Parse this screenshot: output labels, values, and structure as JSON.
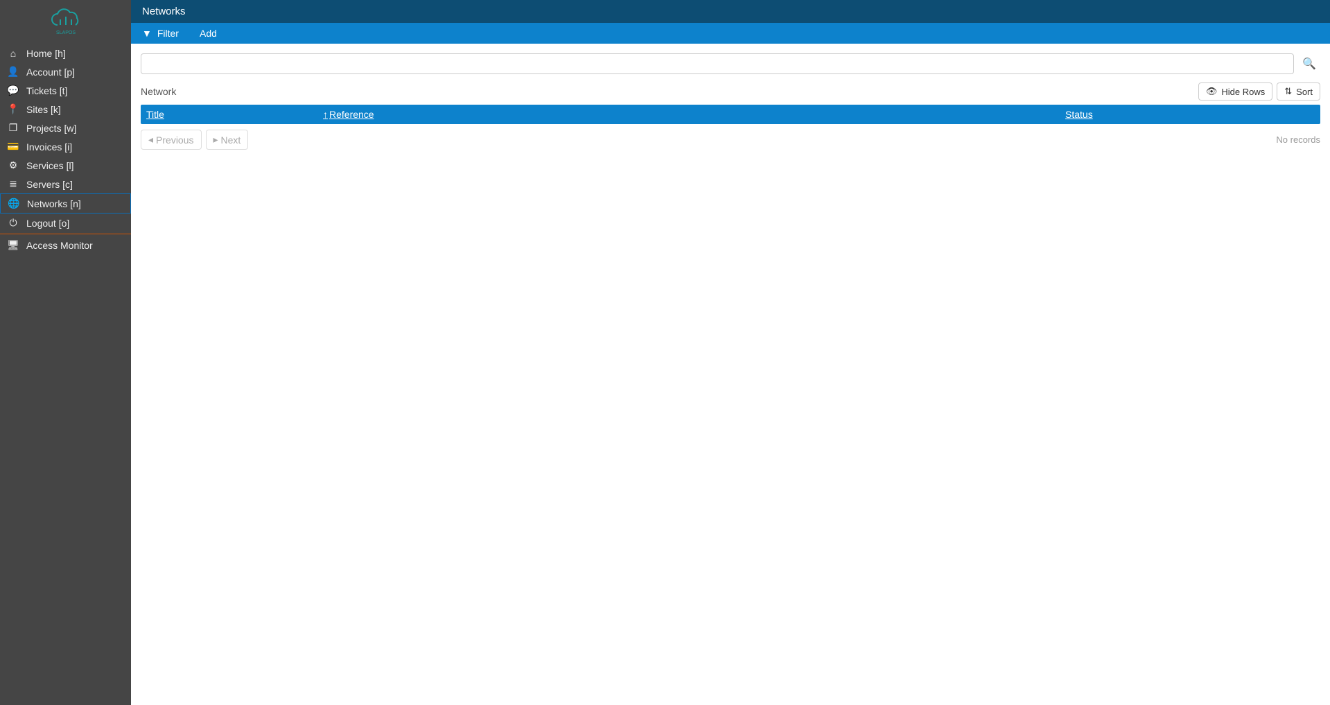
{
  "brand": {
    "name": "SLAPOS"
  },
  "sidebar": {
    "items": [
      {
        "label": "Home [h]",
        "icon": "home"
      },
      {
        "label": "Account [p]",
        "icon": "user"
      },
      {
        "label": "Tickets [t]",
        "icon": "comments"
      },
      {
        "label": "Sites [k]",
        "icon": "marker"
      },
      {
        "label": "Projects [w]",
        "icon": "cubes"
      },
      {
        "label": "Invoices [i]",
        "icon": "card"
      },
      {
        "label": "Services [l]",
        "icon": "cogs"
      },
      {
        "label": "Servers [c]",
        "icon": "database"
      },
      {
        "label": "Networks [n]",
        "icon": "globe"
      },
      {
        "label": "Logout [o]",
        "icon": "power"
      }
    ],
    "secondary": [
      {
        "label": "Access Monitor",
        "icon": "desktop"
      }
    ]
  },
  "header": {
    "title": "Networks"
  },
  "toolbar": {
    "filter_label": "Filter",
    "add_label": "Add"
  },
  "search": {
    "placeholder": ""
  },
  "table": {
    "title": "Network",
    "hide_rows_label": "Hide Rows",
    "sort_label": "Sort",
    "columns": {
      "title": "Title",
      "reference": "Reference",
      "status": "Status"
    },
    "empty": "No records"
  },
  "pager": {
    "previous": "Previous",
    "next": "Next"
  }
}
